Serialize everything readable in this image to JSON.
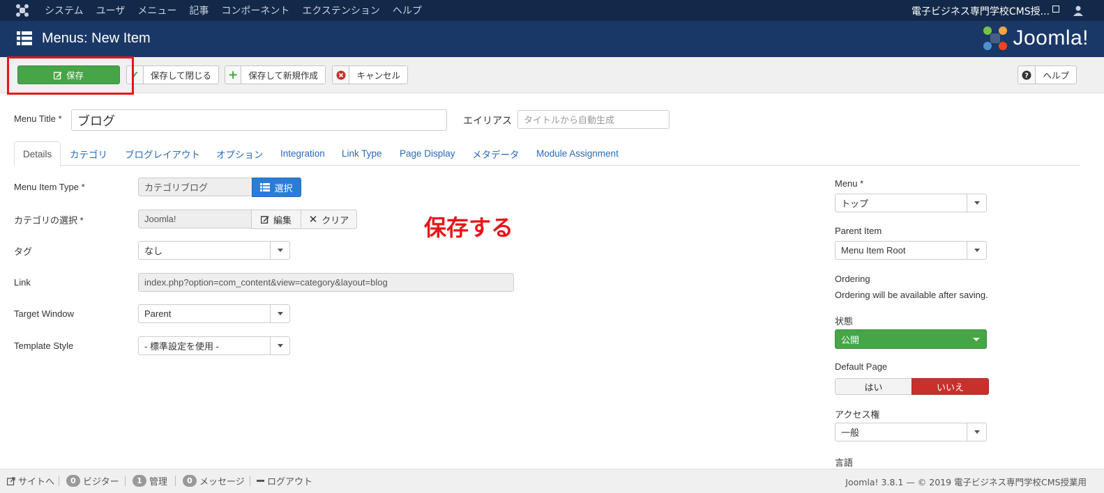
{
  "topbar": {
    "menu": [
      "システム",
      "ユーザ",
      "メニュー",
      "記事",
      "コンポーネント",
      "エクステンション",
      "ヘルプ"
    ],
    "site_name": "電子ビジネス専門学校CMS授..."
  },
  "header": {
    "title": "Menus: New Item",
    "brand": "Joomla!"
  },
  "toolbar": {
    "save": "保存",
    "save_close": "保存して閉じる",
    "save_new": "保存して新規作成",
    "cancel": "キャンセル",
    "help": "ヘルプ"
  },
  "form": {
    "menu_title_label": "Menu Title *",
    "menu_title_value": "ブログ",
    "alias_label": "エイリアス",
    "alias_placeholder": "タイトルから自動生成"
  },
  "tabs": [
    "Details",
    "カテゴリ",
    "ブログレイアウト",
    "オプション",
    "Integration",
    "Link Type",
    "Page Display",
    "メタデータ",
    "Module Assignment"
  ],
  "details": {
    "menu_item_type_label": "Menu Item Type *",
    "menu_item_type_value": "カテゴリブログ",
    "select_btn": "選択",
    "category_label": "カテゴリの選択 *",
    "category_value": "Joomla!",
    "edit_btn": "編集",
    "clear_btn": "クリア",
    "tags_label": "タグ",
    "tags_value": "なし",
    "link_label": "Link",
    "link_value": "index.php?option=com_content&view=category&layout=blog",
    "target_label": "Target Window",
    "target_value": "Parent",
    "template_label": "Template Style",
    "template_value": "- 標準設定を使用 -"
  },
  "annotation": "保存する",
  "sidebar": {
    "menu_label": "Menu *",
    "menu_value": "トップ",
    "parent_label": "Parent Item",
    "parent_value": "Menu Item Root",
    "ordering_label": "Ordering",
    "ordering_text": "Ordering will be available after saving.",
    "status_label": "状態",
    "status_value": "公開",
    "default_label": "Default Page",
    "default_yes": "はい",
    "default_no": "いいえ",
    "access_label": "アクセス権",
    "access_value": "一般",
    "language_label": "言語"
  },
  "footer": {
    "site": "サイトへ",
    "visitors_count": "0",
    "visitors": "ビジター",
    "admins_count": "1",
    "admins": "管理",
    "messages_count": "0",
    "messages": "メッセージ",
    "logout": "ログアウト",
    "copyright": "Joomla! 3.8.1 — © 2019 電子ビジネス専門学校CMS授業用"
  },
  "colors": {
    "topbar": "#13294a",
    "header": "#1a3867",
    "save_green": "#46a546",
    "select_blue": "#2a7dd7",
    "no_red": "#c9302c",
    "annotation_red": "#e8141a"
  }
}
